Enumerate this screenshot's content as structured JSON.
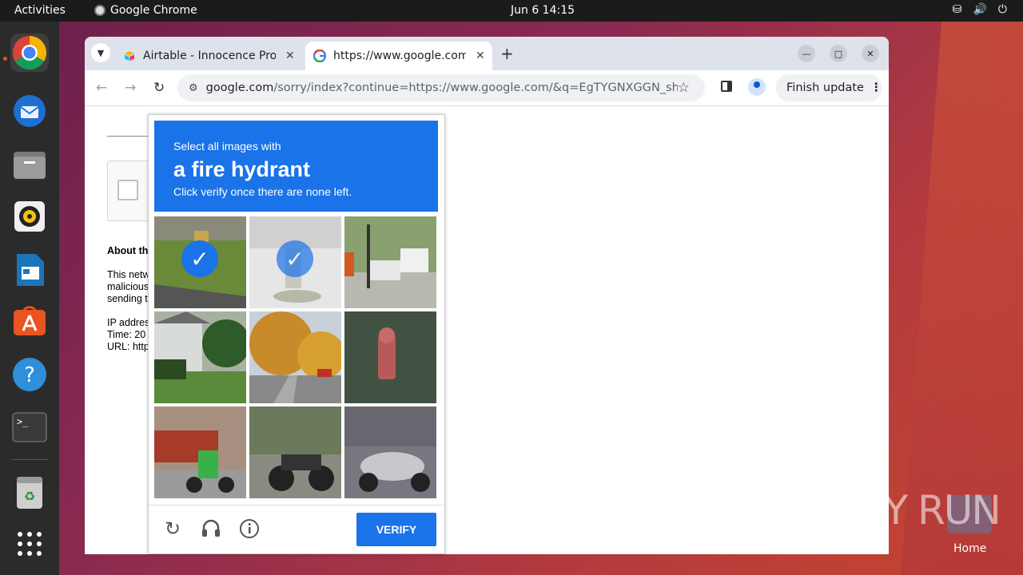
{
  "topbar": {
    "activities": "Activities",
    "app_name": "Google Chrome",
    "clock": "Jun 6  14:15"
  },
  "dock": {
    "items": [
      "chrome-icon",
      "thunderbird-icon",
      "files-icon",
      "rhythmbox-icon",
      "writer-icon",
      "app-center-icon",
      "help-icon",
      "terminal-icon",
      "trash-icon",
      "apps-grid-icon"
    ]
  },
  "desktop": {
    "home_label": "Home",
    "watermark": "ANY RUN"
  },
  "browser": {
    "tabs": [
      {
        "title": "Airtable - Innocence Proj"
      },
      {
        "title": "https://www.google.com"
      }
    ],
    "new_tab": "+",
    "url_host": "google.com",
    "url_path": "/sorry/index?continue=https://www.google.com/&q=EgTYGNXGGN_shrMGIjCZl...",
    "finish_update": "Finish update"
  },
  "page": {
    "about": "About th",
    "line1": "This netw",
    "line2": "malicious",
    "line3": "sending t",
    "ip": "IP addres",
    "time": "Time: 20",
    "url": "URL: http"
  },
  "captcha": {
    "instruction_line1": "Select all images with",
    "target": "a fire hydrant",
    "instruction_line3": "Click verify once there are none left.",
    "verify_label": "VERIFY",
    "tiles": [
      {
        "desc": "hydrant on grass",
        "selected": true
      },
      {
        "desc": "hydrant on pavement",
        "selected": true
      },
      {
        "desc": "street with cars",
        "selected": false
      },
      {
        "desc": "house with lawn",
        "selected": false
      },
      {
        "desc": "autumn street",
        "selected": false
      },
      {
        "desc": "red hydrant",
        "selected": false
      },
      {
        "desc": "scooter riders",
        "selected": false
      },
      {
        "desc": "parked motorcycle",
        "selected": false
      },
      {
        "desc": "parked scooter",
        "selected": false
      }
    ]
  }
}
